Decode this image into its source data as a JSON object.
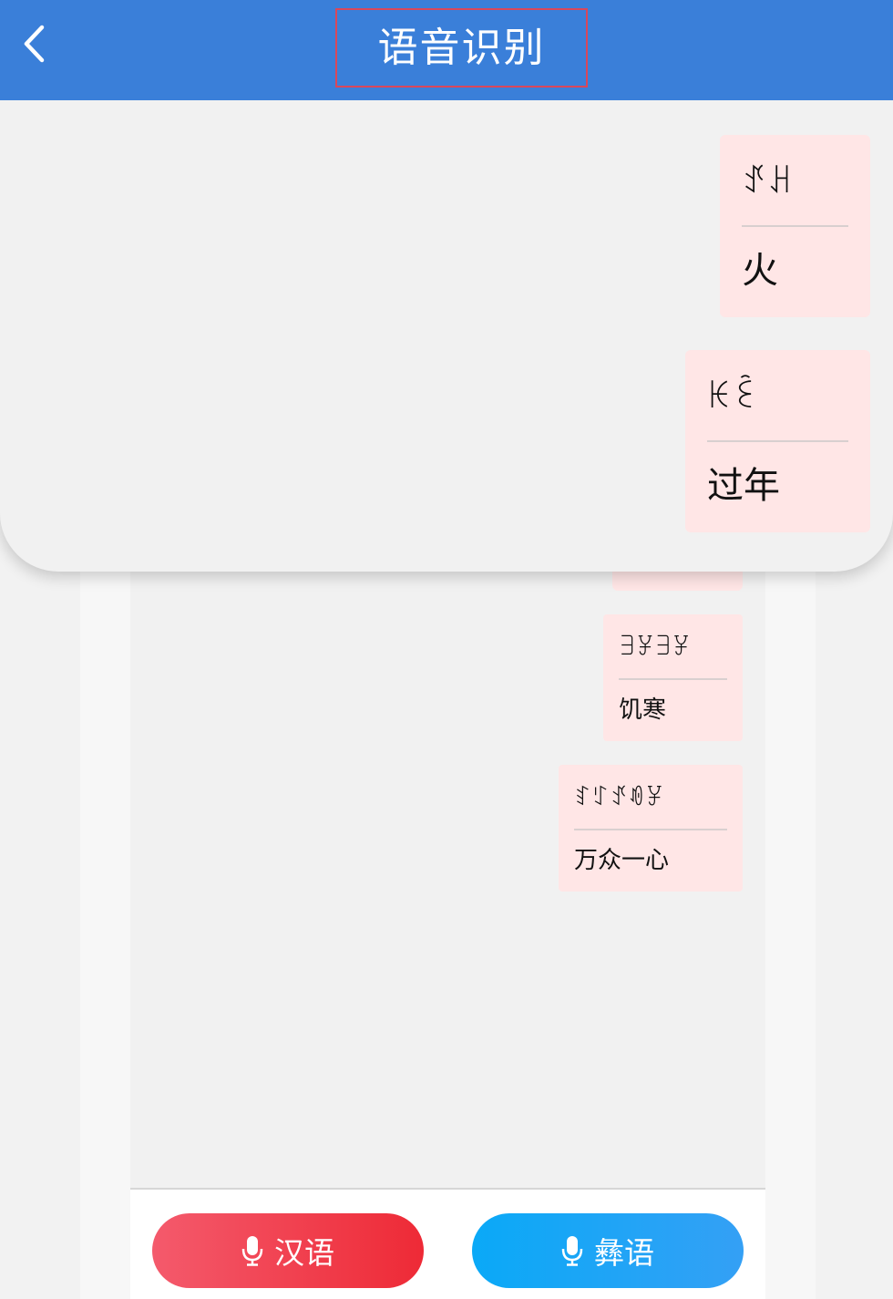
{
  "header": {
    "title": "语音识别",
    "back_icon": "chevron-left-icon",
    "color": "#3a7fd9"
  },
  "messages": [
    {
      "yi": "ꀋꃅ",
      "zh": "火"
    },
    {
      "yi": "ꀘꏁ",
      "zh": "过年"
    },
    {
      "yi": "ꎆꐯꎆꐯ",
      "zh": "饥寒"
    },
    {
      "yi": "ꆏꇰꀋꀑꐯ",
      "zh": "万众一心"
    }
  ],
  "toolbar": {
    "han_label": "汉语",
    "yi_label": "彝语",
    "mic_icon": "microphone-icon",
    "han_color": "#ee2a36",
    "yi_color": "#0aa9f7"
  }
}
